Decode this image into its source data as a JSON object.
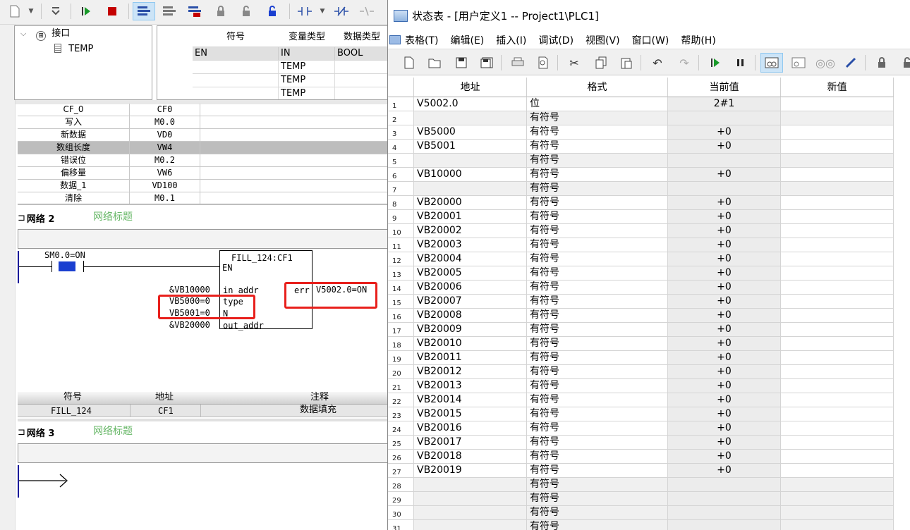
{
  "tree": {
    "root": "接口",
    "child": "TEMP"
  },
  "var_table": {
    "headers": [
      "符号",
      "变量类型",
      "数据类型"
    ],
    "rows": [
      {
        "symbol": "EN",
        "var_type": "IN",
        "data_type": "BOOL"
      },
      {
        "symbol": "",
        "var_type": "TEMP",
        "data_type": ""
      },
      {
        "symbol": "",
        "var_type": "TEMP",
        "data_type": ""
      },
      {
        "symbol": "",
        "var_type": "TEMP",
        "data_type": ""
      }
    ]
  },
  "symbol_rows": [
    {
      "name": "CF_0",
      "addr": "CF0"
    },
    {
      "name": "写入",
      "addr": "M0.0"
    },
    {
      "name": "新数据",
      "addr": "VD0"
    },
    {
      "name": "数组长度",
      "addr": "VW4"
    },
    {
      "name": "错误位",
      "addr": "M0.2"
    },
    {
      "name": "偏移量",
      "addr": "VW6"
    },
    {
      "name": "数据_1",
      "addr": "VD100"
    },
    {
      "name": "清除",
      "addr": "M0.1"
    }
  ],
  "network2": {
    "label": "网络 2",
    "title": "网络标题",
    "contact": "SM0.0=ON",
    "block_name": "FILL_124:CF1",
    "pins": {
      "en": "EN",
      "in_addr": "in_addr",
      "type": "type",
      "n": "N",
      "out_addr": "out_addr",
      "err": "err"
    },
    "inputs": {
      "in_addr": "&VB10000",
      "type": "VB5000=0",
      "n": "VB5001=0",
      "out_addr": "&VB20000"
    },
    "output": "V5002.0=ON"
  },
  "network2_symbols": {
    "headers": [
      "符号",
      "地址",
      "注释"
    ],
    "row": {
      "symbol": "FILL_124",
      "addr": "CF1",
      "comment": "数据填充"
    }
  },
  "network3": {
    "label": "网络 3",
    "title": "网络标题"
  },
  "status_window": {
    "title": "状态表 - [用户定义1 -- Project1\\PLC1]",
    "menu": [
      "表格(T)",
      "编辑(E)",
      "插入(I)",
      "调试(D)",
      "视图(V)",
      "窗口(W)",
      "帮助(H)"
    ],
    "headers": [
      "地址",
      "格式",
      "当前值",
      "新值"
    ],
    "rows": [
      {
        "n": "1",
        "addr": "V5002.0",
        "fmt": "位",
        "val": "2#1"
      },
      {
        "n": "2",
        "addr": "",
        "fmt": "有符号",
        "val": ""
      },
      {
        "n": "3",
        "addr": "VB5000",
        "fmt": "有符号",
        "val": "+0"
      },
      {
        "n": "4",
        "addr": "VB5001",
        "fmt": "有符号",
        "val": "+0"
      },
      {
        "n": "5",
        "addr": "",
        "fmt": "有符号",
        "val": ""
      },
      {
        "n": "6",
        "addr": "VB10000",
        "fmt": "有符号",
        "val": "+0"
      },
      {
        "n": "7",
        "addr": "",
        "fmt": "有符号",
        "val": ""
      },
      {
        "n": "8",
        "addr": "VB20000",
        "fmt": "有符号",
        "val": "+0"
      },
      {
        "n": "9",
        "addr": "VB20001",
        "fmt": "有符号",
        "val": "+0"
      },
      {
        "n": "10",
        "addr": "VB20002",
        "fmt": "有符号",
        "val": "+0"
      },
      {
        "n": "11",
        "addr": "VB20003",
        "fmt": "有符号",
        "val": "+0"
      },
      {
        "n": "12",
        "addr": "VB20004",
        "fmt": "有符号",
        "val": "+0"
      },
      {
        "n": "13",
        "addr": "VB20005",
        "fmt": "有符号",
        "val": "+0"
      },
      {
        "n": "14",
        "addr": "VB20006",
        "fmt": "有符号",
        "val": "+0"
      },
      {
        "n": "15",
        "addr": "VB20007",
        "fmt": "有符号",
        "val": "+0"
      },
      {
        "n": "16",
        "addr": "VB20008",
        "fmt": "有符号",
        "val": "+0"
      },
      {
        "n": "17",
        "addr": "VB20009",
        "fmt": "有符号",
        "val": "+0"
      },
      {
        "n": "18",
        "addr": "VB20010",
        "fmt": "有符号",
        "val": "+0"
      },
      {
        "n": "19",
        "addr": "VB20011",
        "fmt": "有符号",
        "val": "+0"
      },
      {
        "n": "20",
        "addr": "VB20012",
        "fmt": "有符号",
        "val": "+0"
      },
      {
        "n": "21",
        "addr": "VB20013",
        "fmt": "有符号",
        "val": "+0"
      },
      {
        "n": "22",
        "addr": "VB20014",
        "fmt": "有符号",
        "val": "+0"
      },
      {
        "n": "23",
        "addr": "VB20015",
        "fmt": "有符号",
        "val": "+0"
      },
      {
        "n": "24",
        "addr": "VB20016",
        "fmt": "有符号",
        "val": "+0"
      },
      {
        "n": "25",
        "addr": "VB20017",
        "fmt": "有符号",
        "val": "+0"
      },
      {
        "n": "26",
        "addr": "VB20018",
        "fmt": "有符号",
        "val": "+0"
      },
      {
        "n": "27",
        "addr": "VB20019",
        "fmt": "有符号",
        "val": "+0"
      },
      {
        "n": "28",
        "addr": "",
        "fmt": "有符号",
        "val": ""
      },
      {
        "n": "29",
        "addr": "",
        "fmt": "有符号",
        "val": ""
      },
      {
        "n": "30",
        "addr": "",
        "fmt": "有符号",
        "val": ""
      },
      {
        "n": "31",
        "addr": "",
        "fmt": "有符号",
        "val": ""
      }
    ]
  },
  "colors": {
    "highlight": "#e8201c",
    "contact_fill": "#1a3fd0",
    "net_title": "#69b869",
    "selected_row": "#bdbdbd"
  }
}
